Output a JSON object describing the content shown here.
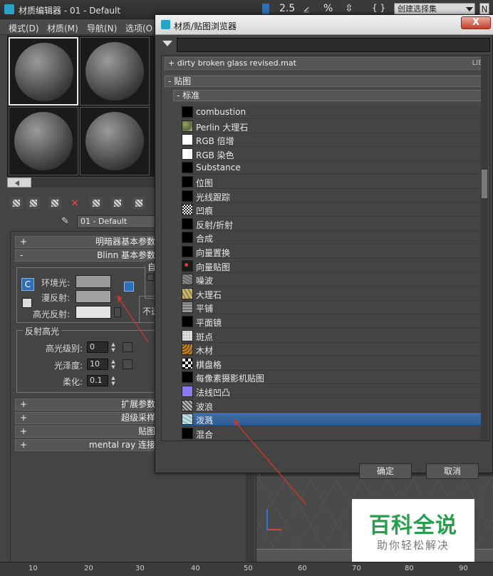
{
  "editor": {
    "title": "材质编辑器 - 01 - Default",
    "menus": [
      "模式(D)",
      "材质(M)",
      "导航(N)",
      "选项(O"
    ],
    "material_name": "01 - Default",
    "rollouts": [
      {
        "sign": "+",
        "label": "明暗器基本参数"
      },
      {
        "sign": "-",
        "label": "Blinn 基本参数"
      }
    ],
    "blinn": {
      "ambient_label": "环境光:",
      "diffuse_label": "漫反射:",
      "specular_label": "高光反射:",
      "self_illum_partial": "自",
      "opacity_partial": "不透",
      "ambient_color": "#9a9a9a",
      "diffuse_color": "#a2a2a2",
      "specular_color": "#e4e4e4",
      "lock_label": "C"
    },
    "specular": {
      "group_title": "反射高光",
      "level_label": "高光级别:",
      "level_value": "0",
      "gloss_label": "光泽度:",
      "gloss_value": "10",
      "soften_label": "柔化:",
      "soften_value": "0.1"
    },
    "bottom_rollouts": [
      {
        "sign": "+",
        "label": "扩展参数"
      },
      {
        "sign": "+",
        "label": "超级采样"
      },
      {
        "sign": "+",
        "label": "贴图"
      },
      {
        "sign": "+",
        "label": "mental ray 连接"
      }
    ]
  },
  "toolbar": {
    "value": "2.5",
    "percent": "%",
    "braces": "{ }",
    "named_selection": "创建选择集"
  },
  "browser": {
    "title": "材质/贴图浏览器",
    "close_label": "X",
    "search_placeholder": "",
    "library": {
      "sign": "+",
      "name": "dirty broken glass revised.mat",
      "tag": "LIB"
    },
    "maps_category": "- 贴图",
    "standard_category": "- 标准",
    "items": [
      {
        "name": "combustion",
        "icon": "black",
        "selected": false
      },
      {
        "name": "Perlin 大理石",
        "icon": "perlin-marble",
        "selected": false
      },
      {
        "name": "RGB 倍增",
        "icon": "white",
        "selected": false
      },
      {
        "name": "RGB 染色",
        "icon": "white",
        "selected": false
      },
      {
        "name": "Substance",
        "icon": "black",
        "selected": false
      },
      {
        "name": "位图",
        "icon": "black",
        "selected": false
      },
      {
        "name": "光线跟踪",
        "icon": "black",
        "selected": false
      },
      {
        "name": "凹痕",
        "icon": "dent",
        "selected": false
      },
      {
        "name": "反射/折射",
        "icon": "black",
        "selected": false
      },
      {
        "name": "合成",
        "icon": "black",
        "selected": false
      },
      {
        "name": "向量置换",
        "icon": "black",
        "selected": false
      },
      {
        "name": "向量贴图",
        "icon": "vector-map",
        "selected": false
      },
      {
        "name": "噪波",
        "icon": "noise",
        "selected": false
      },
      {
        "name": "大理石",
        "icon": "marble",
        "selected": false
      },
      {
        "name": "平铺",
        "icon": "tiles",
        "selected": false
      },
      {
        "name": "平面镜",
        "icon": "black",
        "selected": false
      },
      {
        "name": "斑点",
        "icon": "speckle",
        "selected": false
      },
      {
        "name": "木材",
        "icon": "wood",
        "selected": false
      },
      {
        "name": "棋盘格",
        "icon": "checker",
        "selected": false
      },
      {
        "name": "每像素摄影机贴图",
        "icon": "black",
        "selected": false
      },
      {
        "name": "法线凹凸",
        "icon": "normal-bump",
        "selected": false
      },
      {
        "name": "波浪",
        "icon": "waves",
        "selected": false
      },
      {
        "name": "泼溅",
        "icon": "splat",
        "selected": true
      },
      {
        "name": "混合",
        "icon": "black",
        "selected": false
      }
    ],
    "ok_label": "确定",
    "cancel_label": "取消"
  },
  "ruler_ticks": [
    "10",
    "20",
    "30",
    "40",
    "50",
    "60",
    "70",
    "80",
    "90"
  ],
  "watermark": {
    "big": "百科全说",
    "small": "助你轻松解决"
  }
}
